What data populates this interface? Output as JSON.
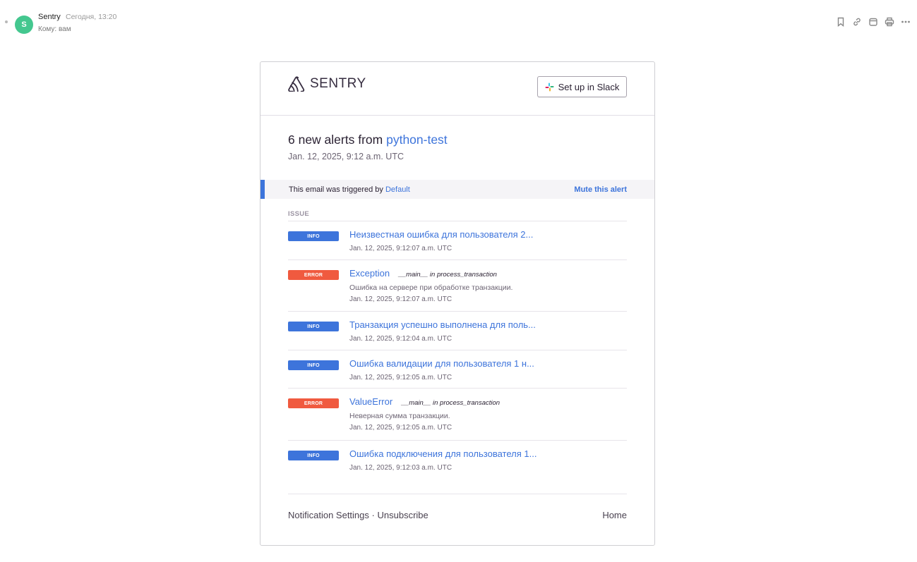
{
  "mail": {
    "avatar_letter": "S",
    "sender": "Sentry",
    "date": "Сегодня, 13:20",
    "to_label": "Кому:",
    "to_value": "вам",
    "toolbar_icons": [
      "bookmark-icon",
      "link-icon",
      "calendar-icon",
      "print-icon",
      "more-icon"
    ]
  },
  "email": {
    "logo_text": "SENTRY",
    "slack_button": "Set up in Slack",
    "title_prefix": "6 new alerts from",
    "project": "python-test",
    "date": "Jan. 12, 2025, 9:12 a.m. UTC",
    "trigger_text": "This email was triggered by",
    "trigger_rule": "Default",
    "mute_link": "Mute this alert",
    "issue_header": "ISSUE",
    "issues": [
      {
        "level": "INFO",
        "title": "Неизвестная ошибка для пользователя 2...",
        "culprit": "",
        "message": "",
        "date": "Jan. 12, 2025, 9:12:07 a.m. UTC"
      },
      {
        "level": "ERROR",
        "title": "Exception",
        "culprit": "__main__ in process_transaction",
        "message": "Ошибка на сервере при обработке транзакции.",
        "date": "Jan. 12, 2025, 9:12:07 a.m. UTC"
      },
      {
        "level": "INFO",
        "title": "Транзакция успешно выполнена для поль...",
        "culprit": "",
        "message": "",
        "date": "Jan. 12, 2025, 9:12:04 a.m. UTC"
      },
      {
        "level": "INFO",
        "title": "Ошибка валидации для пользователя 1 н...",
        "culprit": "",
        "message": "",
        "date": "Jan. 12, 2025, 9:12:05 a.m. UTC"
      },
      {
        "level": "ERROR",
        "title": "ValueError",
        "culprit": "__main__ in process_transaction",
        "message": "Неверная сумма транзакции.",
        "date": "Jan. 12, 2025, 9:12:05 a.m. UTC"
      },
      {
        "level": "INFO",
        "title": "Ошибка подключения для пользователя 1...",
        "culprit": "",
        "message": "",
        "date": "Jan. 12, 2025, 9:12:03 a.m. UTC"
      }
    ],
    "footer": {
      "notification_settings": "Notification Settings",
      "separator": "·",
      "unsubscribe": "Unsubscribe",
      "home": "Home"
    }
  },
  "colors": {
    "accent": "#3d74db",
    "error": "#f05a3f",
    "avatar": "#44c78f"
  }
}
